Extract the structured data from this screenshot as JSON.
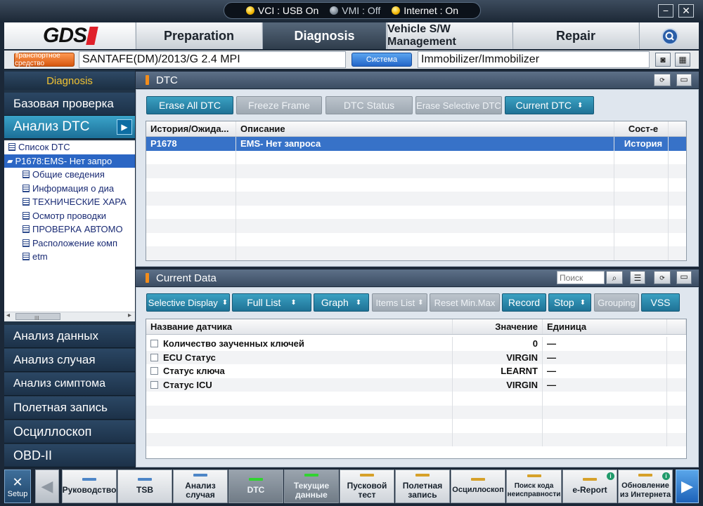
{
  "topbar": {
    "vci": "VCI : USB On",
    "vmi": "VMI : Off",
    "internet": "Internet : On",
    "minimize": "−",
    "close": "✕"
  },
  "logo": "GDS",
  "nav": {
    "tabs": [
      "Preparation",
      "Diagnosis",
      "Vehicle S/W Management",
      "Repair"
    ],
    "active": "Diagnosis"
  },
  "vehicle": {
    "vehicle_button": "Транспортное средство",
    "vehicle_value": "SANTAFE(DM)/2013/G 2.4 MPI",
    "system_button": "Система",
    "system_value": "Immobilizer/Immobilizer"
  },
  "sidebar": {
    "header": "Diagnosis",
    "items_top": [
      "Базовая проверка",
      "Анализ DTC"
    ],
    "tree": [
      "Список DTC",
      "P1678:EMS- Нет запро",
      "Общие сведения",
      "Информация о диа",
      "ТЕХНИЧЕСКИЕ ХАРА",
      "Осмотр проводки",
      "ПРОВЕРКА АВТОМО",
      "Расположение комп",
      "etm"
    ],
    "items_bottom": [
      "Анализ данных",
      "Анализ случая",
      "Анализ симптома",
      "Полетная запись",
      "Осциллоскоп",
      "OBD-II"
    ],
    "scroll_mark": "III"
  },
  "dtc_panel": {
    "title": "DTC",
    "buttons": [
      "Erase All DTC",
      "Freeze Frame",
      "DTC Status",
      "Erase Selective DTC",
      "Current DTC"
    ],
    "columns": [
      "История/Ожида...",
      "Описание",
      "Сост-е"
    ],
    "rows": [
      {
        "code": "P1678",
        "desc": "EMS- Нет запроса",
        "state": "История"
      }
    ]
  },
  "current_data": {
    "title": "Current Data",
    "search_placeholder": "Поиск",
    "buttons": [
      "Selective Display",
      "Full List",
      "Graph",
      "Items List",
      "Reset Min.Max",
      "Record",
      "Stop",
      "Grouping",
      "VSS"
    ],
    "columns": [
      "Название датчика",
      "Значение",
      "Единица"
    ],
    "rows": [
      {
        "name": "Количество заученных ключей",
        "value": "0",
        "unit": "—"
      },
      {
        "name": "ECU Статус",
        "value": "VIRGIN",
        "unit": "—"
      },
      {
        "name": "Статус ключа",
        "value": "LEARNT",
        "unit": "—"
      },
      {
        "name": "Статус ICU",
        "value": "VIRGIN",
        "unit": "—"
      }
    ]
  },
  "bottom": {
    "setup": "Setup",
    "buttons": [
      "Руководство",
      "TSB",
      "Анализ случая",
      "DTC",
      "Текущие данные",
      "Пусковой тест",
      "Полетная запись",
      "Осциллоскоп",
      "Поиск кода неисправности",
      "e-Report",
      "Обновление из Интернета"
    ]
  }
}
